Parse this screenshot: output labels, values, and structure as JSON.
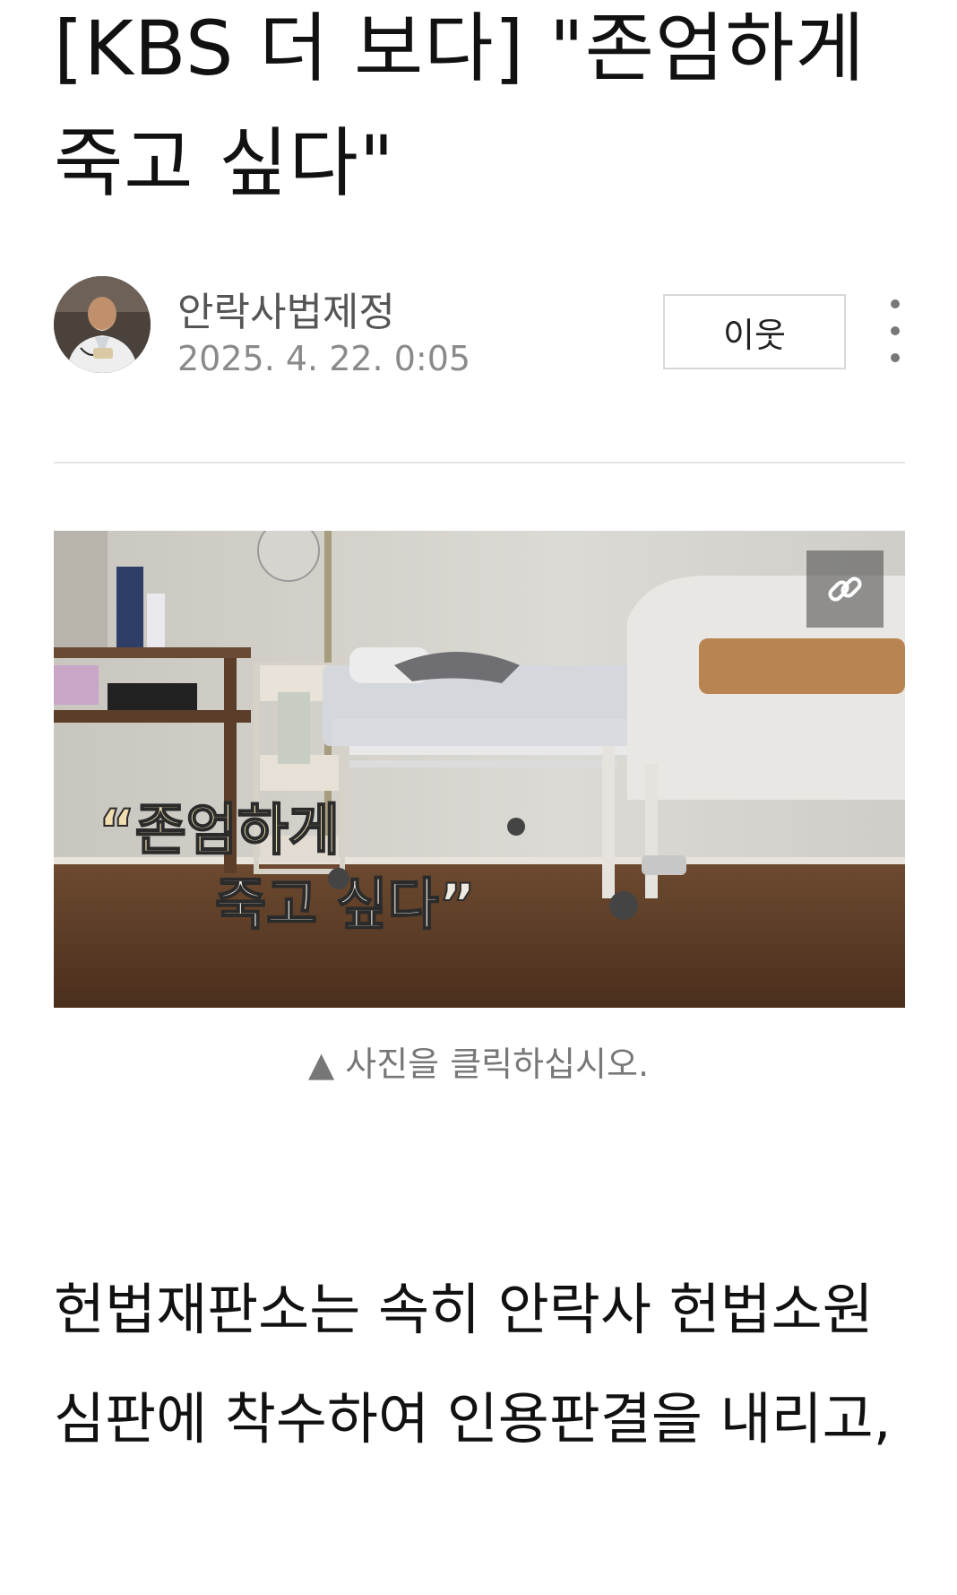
{
  "article": {
    "title": "[KBS 더 보다] \"존엄하게 죽고 싶다\""
  },
  "author": {
    "name": "안락사법제정",
    "date": "2025. 4. 22. 0:05",
    "neighbor_label": "이웃"
  },
  "photo": {
    "overlay_line1": "“존엄하게",
    "overlay_line2": "죽고 싶다”",
    "caption": "▲ 사진을 클릭하십시오."
  },
  "body": {
    "paragraph": "헌법재판소는 속히 안락사 헌법소원심판에 착수하여 인용판결을 내리고,"
  },
  "icons": {
    "more": "more-vertical-icon",
    "link": "link-icon"
  }
}
